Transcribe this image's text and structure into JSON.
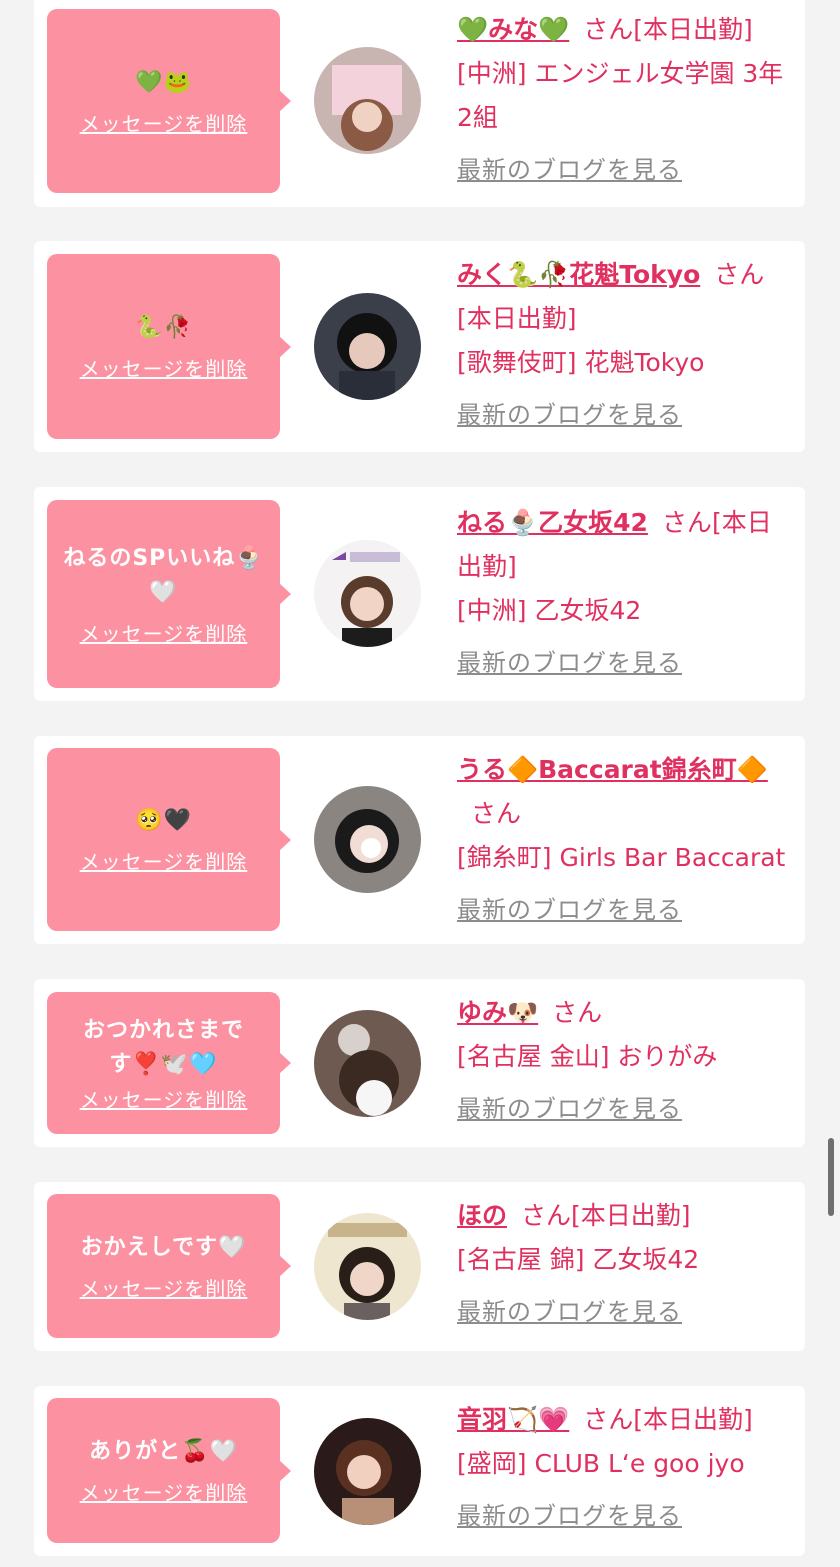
{
  "items": [
    {
      "message": "💚🐸",
      "delete": "メッセージを削除",
      "name": "💚みな💚",
      "san": "さん",
      "status": "[本日出勤]",
      "shop": "[中洲] エンジェル女学園 3年2組",
      "blog": "最新のブログを見る"
    },
    {
      "message": "🐍🥀",
      "delete": "メッセージを削除",
      "name": "みく🐍🥀花魁Tokyo",
      "san": "さん",
      "status": "[本日出勤]",
      "shop": "[歌舞伎町] 花魁Tokyo",
      "blog": "最新のブログを見る"
    },
    {
      "message": "ねるのSPいいね🍨🤍",
      "delete": "メッセージを削除",
      "name": "ねる🍨乙女坂42",
      "san": "さん",
      "status": "[本日出勤]",
      "shop": "[中洲] 乙女坂42",
      "blog": "最新のブログを見る"
    },
    {
      "message": "🥺🖤",
      "delete": "メッセージを削除",
      "name": "うる🔶Baccarat錦糸町🔶",
      "san": "さん",
      "status": "",
      "shop": "[錦糸町] Girls Bar Baccarat",
      "blog": "最新のブログを見る"
    },
    {
      "message": "おつかれさまです❣️🕊️🩵",
      "delete": "メッセージを削除",
      "name": "ゆみ🐶",
      "san": "さん",
      "status": "",
      "shop": "[名古屋 金山] おりがみ",
      "blog": "最新のブログを見る"
    },
    {
      "message": "おかえしです🤍",
      "delete": "メッセージを削除",
      "name": "ほの",
      "san": "さん",
      "status": "[本日出勤]",
      "shop": "[名古屋 錦] 乙女坂42",
      "blog": "最新のブログを見る"
    },
    {
      "message": "ありがと🍒🤍",
      "delete": "メッセージを削除",
      "name": "音羽🏹💗",
      "san": "さん",
      "status": "[本日出勤]",
      "shop": "[盛岡] CLUB L‘e goo jyo",
      "blog": "最新のブログを見る"
    }
  ],
  "colors": {
    "bubble": "#fc92a1",
    "accent": "#e03060",
    "muted": "#8c8c8c",
    "background": "#f3f3f3"
  }
}
